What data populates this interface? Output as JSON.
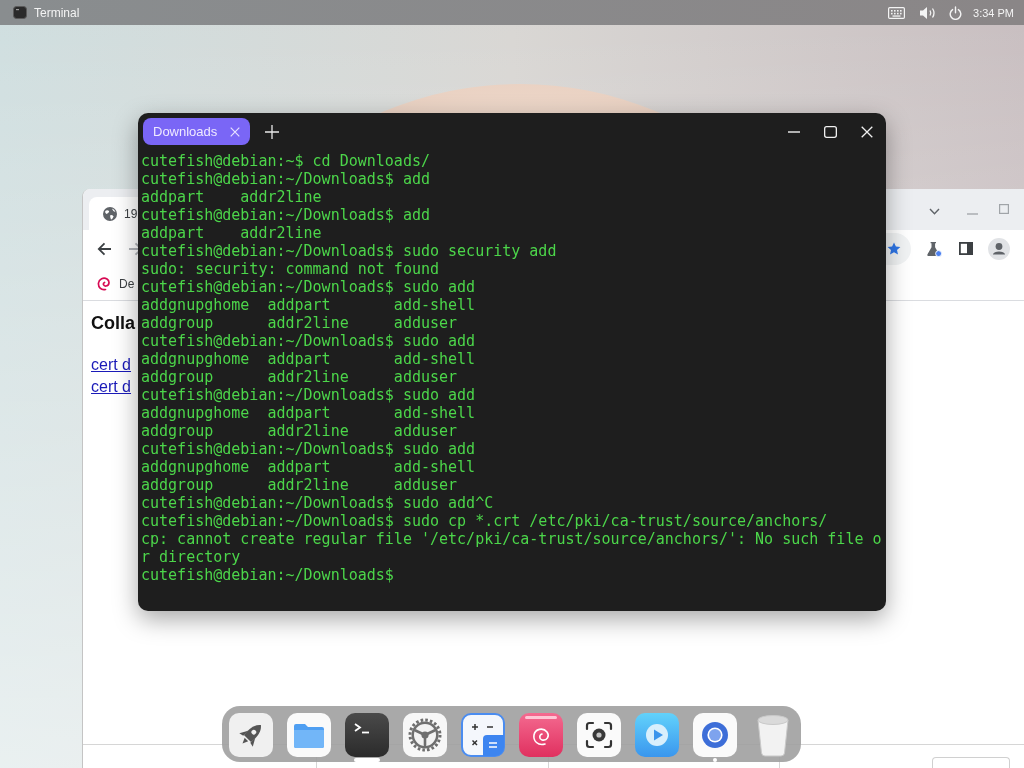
{
  "top_panel": {
    "app_name": "Terminal",
    "clock": "3:34 PM"
  },
  "browser": {
    "tab": {
      "title": "19"
    },
    "bookmarks": [
      {
        "label": "De"
      }
    ],
    "page": {
      "heading": "Colla",
      "links": [
        "cert d",
        "cert d"
      ]
    }
  },
  "terminal": {
    "tabs": [
      {
        "label": "Downloads",
        "selected": true
      }
    ],
    "lines": [
      "cutefish@debian:~$ cd Downloads/",
      "cutefish@debian:~/Downloads$ add",
      "addpart    addr2line",
      "cutefish@debian:~/Downloads$ add",
      "addpart    addr2line",
      "cutefish@debian:~/Downloads$ sudo security add",
      "sudo: security: command not found",
      "cutefish@debian:~/Downloads$ sudo add",
      "addgnupghome  addpart       add-shell",
      "addgroup      addr2line     adduser",
      "cutefish@debian:~/Downloads$ sudo add",
      "addgnupghome  addpart       add-shell",
      "addgroup      addr2line     adduser",
      "cutefish@debian:~/Downloads$ sudo add",
      "addgnupghome  addpart       add-shell",
      "addgroup      addr2line     adduser",
      "cutefish@debian:~/Downloads$ sudo add",
      "addgnupghome  addpart       add-shell",
      "addgroup      addr2line     adduser",
      "cutefish@debian:~/Downloads$ sudo add^C",
      "cutefish@debian:~/Downloads$ sudo cp *.crt /etc/pki/ca-trust/source/anchors/",
      "cp: cannot create regular file '/etc/pki/ca-trust/source/anchors/': No such file o",
      "r directory",
      "cutefish@debian:~/Downloads$"
    ]
  },
  "dock": {
    "items": [
      {
        "kind": "launcher",
        "running": false,
        "focused": false
      },
      {
        "kind": "files",
        "running": false,
        "focused": false
      },
      {
        "kind": "terminal",
        "running": true,
        "focused": true
      },
      {
        "kind": "settings",
        "running": false,
        "focused": false
      },
      {
        "kind": "calculator",
        "running": false,
        "focused": false
      },
      {
        "kind": "debian",
        "running": false,
        "focused": false
      },
      {
        "kind": "screenshot",
        "running": false,
        "focused": false
      },
      {
        "kind": "video",
        "running": false,
        "focused": false
      },
      {
        "kind": "browser",
        "running": true,
        "focused": false
      },
      {
        "kind": "trash",
        "running": false,
        "focused": false
      }
    ]
  }
}
